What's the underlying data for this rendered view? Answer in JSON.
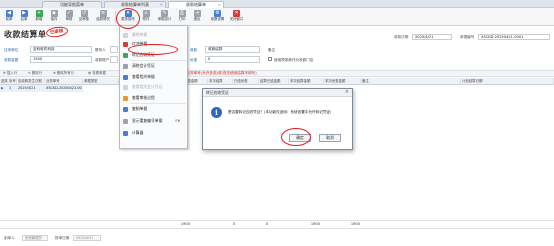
{
  "tabs": [
    {
      "label": "功能导航菜单",
      "closable": false
    },
    {
      "label": "收款结算单列表",
      "closable": true
    },
    {
      "label": "收款结算单",
      "closable": true,
      "active": true
    }
  ],
  "toolbar": {
    "items": [
      {
        "label": "前单",
        "icon": "arrow-left-icon",
        "color": "#4a7fd0"
      },
      {
        "label": "后单",
        "icon": "arrow-right-icon",
        "color": "#4a7fd0"
      },
      {
        "label": "新增",
        "icon": "add-icon",
        "color": "#3aa757"
      },
      {
        "label": "保存",
        "icon": "save-icon",
        "color": "#9aa3ad"
      },
      {
        "label": "审核",
        "icon": "audit-icon",
        "color": "#9aa3ad"
      },
      {
        "label": "反审核",
        "icon": "unaudit-icon",
        "color": "#9aa3ad"
      },
      {
        "label": "结算情况",
        "icon": "settlement-icon",
        "color": "#9aa3ad"
      },
      {
        "label": "更多操作",
        "icon": "more-icon",
        "color": "#4a7fd0"
      },
      {
        "label": "附件",
        "icon": "attachment-icon",
        "color": "#9aa3ad"
      },
      {
        "label": "单据设计",
        "icon": "design-icon",
        "color": "#9aa3ad"
      },
      {
        "label": "打印",
        "icon": "print-icon",
        "color": "#9aa3ad"
      },
      {
        "label": "退出",
        "icon": "exit-icon",
        "color": "#9aa3ad"
      },
      {
        "label": "参数设置",
        "icon": "settings-icon",
        "color": "#4a7fd0"
      },
      {
        "label": "关闭窗口",
        "icon": "close-window-icon",
        "color": "#d93a3a"
      }
    ]
  },
  "header": {
    "title": "收款结算单",
    "stamp": "已审核",
    "date_label": "收款日期",
    "date_value": "2025/4/21",
    "docno_label": "单据编号",
    "docno_value": "XSCKD-20250421-0001"
  },
  "form": {
    "org_label": "往来单位",
    "org_value": "至科软件科技",
    "contact_label": "联系人",
    "amount_label": "收款金额",
    "amount_value": "1900",
    "account_label": "收款账户",
    "method_label": "收款",
    "method_value": "收款结算",
    "remark_label": "备注",
    "discount_label": "优惠",
    "discount_value": "0",
    "checkbox_label": "使用预收款作为收款门店"
  },
  "subbar": {
    "items": [
      "插入行",
      "删除行",
      "删除所有行",
      "查看单据"
    ],
    "hint": "双击选择业务单号(允许多选)或(双击使用结算不填写)"
  },
  "grid": {
    "columns": [
      "选择",
      "序号",
      "应收款发生日期",
      "业务单号",
      "单据类型",
      "单据金额",
      "已结金额",
      "优惠金额",
      "本次结算",
      "已结优惠",
      "结算已结金额",
      "本次结算金额",
      "本次优惠金额",
      "备注",
      "计划结算日期"
    ],
    "rows": [
      [
        "▶",
        "1",
        "2025/4/21",
        "XSCKD-20250421-0001",
        "",
        "",
        "",
        "",
        "",
        "",
        "",
        "",
        "",
        "",
        ""
      ]
    ]
  },
  "footer": {
    "sums": [
      "1900",
      "0",
      "0",
      "1900",
      "1900"
    ],
    "maker_label": "制单人",
    "maker_value": "系统管理员",
    "audit_date_label": "核审日期",
    "audit_date_value": "2025/4/21"
  },
  "menu": {
    "items": [
      {
        "label": "删除单据",
        "disabled": true,
        "icon_color": "#d0d4d9"
      },
      {
        "label": "红冲单据",
        "disabled": false,
        "icon_color": "#d93a3a"
      },
      {
        "label": "转记应收凭证",
        "disabled": false,
        "icon_color": "#3aa757"
      },
      {
        "label": "清除会计凭证",
        "disabled": false,
        "icon_color": "#9aa3ad"
      },
      {
        "label": "查看相关单据",
        "disabled": false,
        "icon_color": "#4a7fd0"
      },
      {
        "label": "查看相关会计凭证",
        "disabled": true,
        "icon_color": "#d0d4d9"
      },
      {
        "label": "查看审核过程",
        "disabled": false,
        "icon_color": "#e39b2b"
      },
      {
        "label": "复制单据",
        "disabled": false,
        "icon_color": "#4a7fd0"
      },
      {
        "label": "显示重复编号单据",
        "disabled": false,
        "icon_color": "#9aa3ad",
        "shortcut": "F6"
      },
      {
        "label": "计算器",
        "disabled": false,
        "icon_color": "#4a7fd0"
      }
    ]
  },
  "dialog": {
    "title": "转记应收凭证",
    "message": "是否要转记应收凭证？(本功能仅适用：系统设置中允许转记凭证)",
    "ok_label": "确定",
    "cancel_label": "取消"
  },
  "colors": {
    "accent": "#2a5db0",
    "annotation": "#e02020",
    "info": "#2a67c9"
  }
}
